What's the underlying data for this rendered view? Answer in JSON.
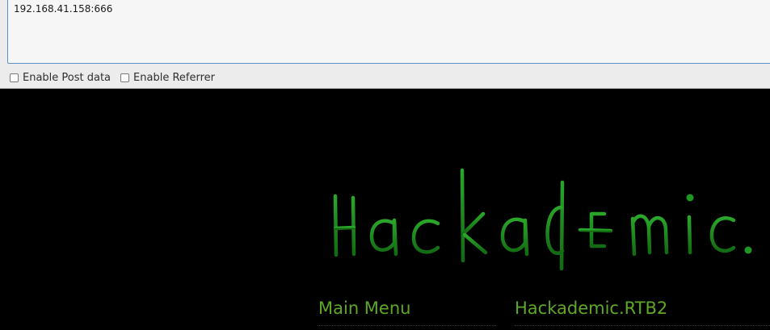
{
  "request": {
    "url_value": "192.168.41.158:666"
  },
  "options": {
    "post_label": "Enable Post data",
    "referrer_label": "Enable Referrer"
  },
  "page": {
    "logo_text": "Hackademic.",
    "main_menu_label": "Main Menu",
    "site_title_label": "Hackademic.RTB2"
  },
  "colors": {
    "logo_green": "#1e8a1e",
    "menu_green": "#5fa826",
    "background": "#000000",
    "field_border": "#5a8fc8"
  }
}
